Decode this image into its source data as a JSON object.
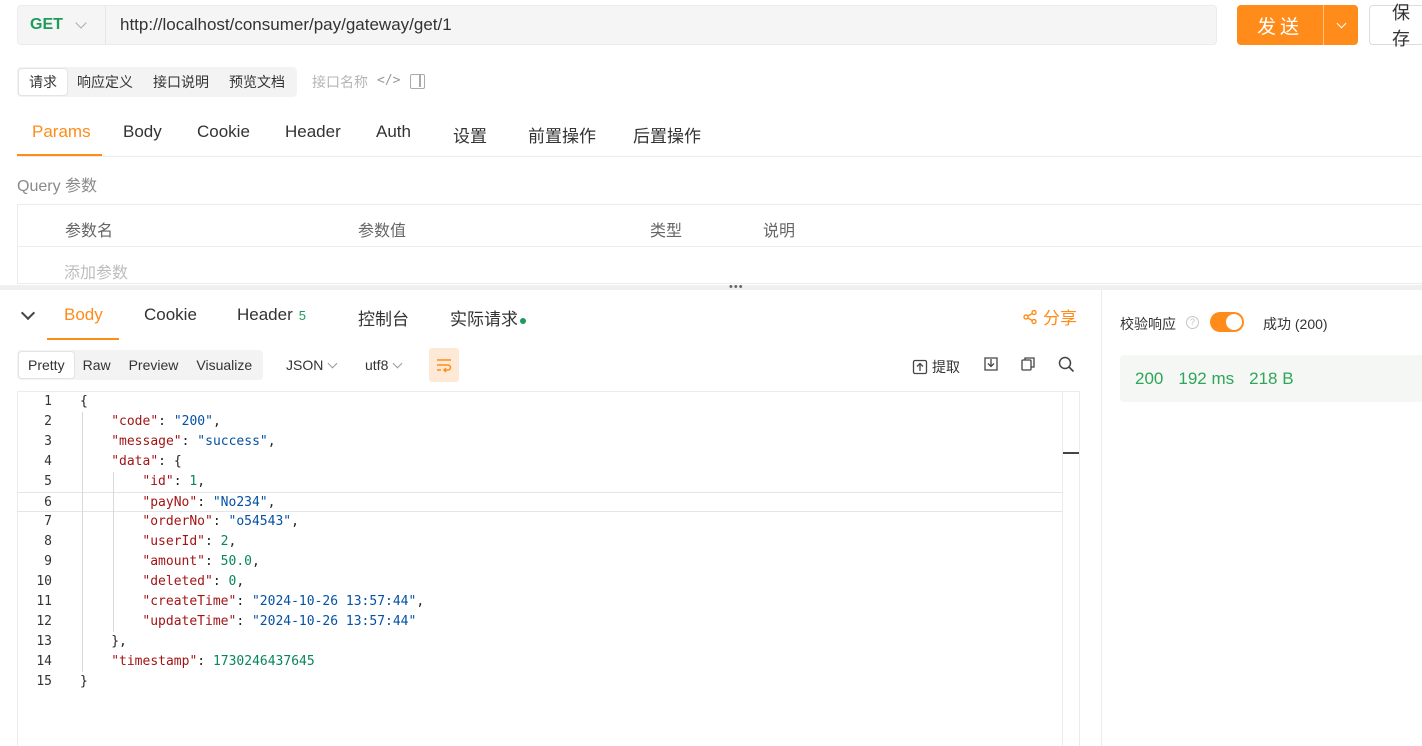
{
  "request": {
    "method": "GET",
    "url": "http://localhost/consumer/pay/gateway/get/1",
    "send_label": "发送",
    "save_label": "保存"
  },
  "request_subtabs": [
    "请求",
    "响应定义",
    "接口说明",
    "预览文档"
  ],
  "name_placeholder": "接口名称",
  "param_tabs": [
    "Params",
    "Body",
    "Cookie",
    "Header",
    "Auth",
    "设置",
    "前置操作",
    "后置操作"
  ],
  "query": {
    "title": "Query 参数",
    "columns": [
      "参数名",
      "参数值",
      "类型",
      "说明"
    ],
    "add_placeholder": "添加参数"
  },
  "response": {
    "tabs": {
      "body": "Body",
      "cookie": "Cookie",
      "header": "Header",
      "header_count": "5",
      "console": "控制台",
      "actual": "实际请求"
    },
    "share_label": "分享",
    "formats": [
      "Pretty",
      "Raw",
      "Preview",
      "Visualize"
    ],
    "content_type": "JSON",
    "encoding": "utf8",
    "extract_label": "提取"
  },
  "code": {
    "line_numbers": [
      "1",
      "2",
      "3",
      "4",
      "5",
      "6",
      "7",
      "8",
      "9",
      "10",
      "11",
      "12",
      "13",
      "14",
      "15"
    ],
    "lines": [
      {
        "indent": 0,
        "open": "{"
      },
      {
        "indent": 1,
        "key": "code",
        "str": "200",
        "comma": true
      },
      {
        "indent": 1,
        "key": "message",
        "str": "success",
        "comma": true
      },
      {
        "indent": 1,
        "key": "data",
        "open": "{"
      },
      {
        "indent": 2,
        "key": "id",
        "num": "1",
        "comma": true
      },
      {
        "indent": 2,
        "key": "payNo",
        "str": "No234",
        "comma": true
      },
      {
        "indent": 2,
        "key": "orderNo",
        "str": "o54543",
        "comma": true
      },
      {
        "indent": 2,
        "key": "userId",
        "num": "2",
        "comma": true
      },
      {
        "indent": 2,
        "key": "amount",
        "num": "50.0",
        "comma": true
      },
      {
        "indent": 2,
        "key": "deleted",
        "num": "0",
        "comma": true
      },
      {
        "indent": 2,
        "key": "createTime",
        "str": "2024-10-26 13:57:44",
        "comma": true
      },
      {
        "indent": 2,
        "key": "updateTime",
        "str": "2024-10-26 13:57:44"
      },
      {
        "indent": 1,
        "close": "},"
      },
      {
        "indent": 1,
        "key": "timestamp",
        "num": "1730246437645"
      },
      {
        "indent": 0,
        "close": "}"
      }
    ]
  },
  "status": {
    "verify_label": "校验响应",
    "verify_result": "成功 (200)",
    "code": "200",
    "time": "192 ms",
    "size": "218 B"
  },
  "colors": {
    "accent": "#ff8c1a",
    "success": "#1e9c5a"
  }
}
